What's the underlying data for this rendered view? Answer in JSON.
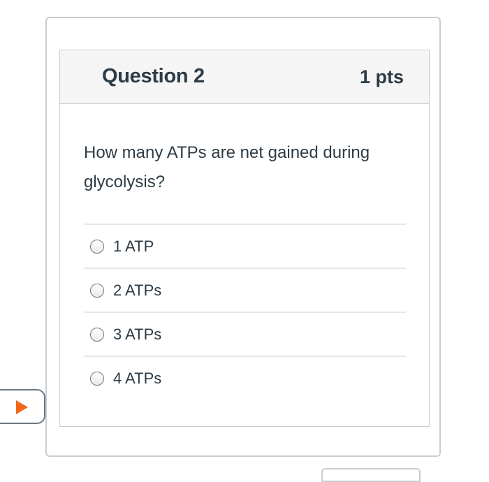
{
  "question": {
    "title": "Question 2",
    "points": "1 pts",
    "text": "How many ATPs are net gained during glycolysis?"
  },
  "answers": [
    {
      "label": "1 ATP",
      "selected": false
    },
    {
      "label": "2 ATPs",
      "selected": false
    },
    {
      "label": "3 ATPs",
      "selected": false
    },
    {
      "label": "4 ATPs",
      "selected": false
    }
  ],
  "colors": {
    "play_icon": "#f2661c",
    "header_bg": "#f5f5f5",
    "border": "#c7cdd1",
    "text": "#2d3b45"
  },
  "icons": {
    "play": "play-icon"
  }
}
